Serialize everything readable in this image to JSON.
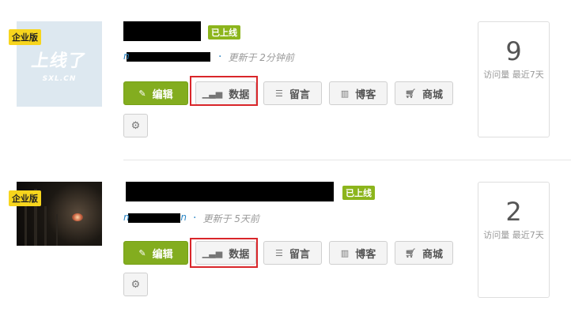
{
  "sites": [
    {
      "badge": "企业版",
      "status": "已上线",
      "thumbnail_text": {
        "title": "上线了",
        "subtitle": "SXL.CN"
      },
      "domain_edge": "n",
      "updated": "更新于 2分钟前",
      "visits": "9",
      "visits_label": "访问量 最近7天"
    },
    {
      "badge": "企业版",
      "status": "已上线",
      "domain_edge": "n",
      "domain_edge_end": "n",
      "updated": "更新于 5天前",
      "visits": "2",
      "visits_label": "访问量 最近7天"
    }
  ],
  "actions": {
    "edit": "编辑",
    "data": "数据",
    "message": "留言",
    "blog": "博客",
    "shop": "商城"
  },
  "icons": {
    "edit": "pencil-icon",
    "data": "bar-chart-icon",
    "message": "list-icon",
    "blog": "book-icon",
    "shop": "cart-icon",
    "settings": "gear-icon"
  },
  "colors": {
    "primary": "#83ad1f",
    "status": "#8cb51c",
    "enterprise_badge": "#f7d51d",
    "highlight": "#d9262a",
    "link": "#2b86c5"
  }
}
